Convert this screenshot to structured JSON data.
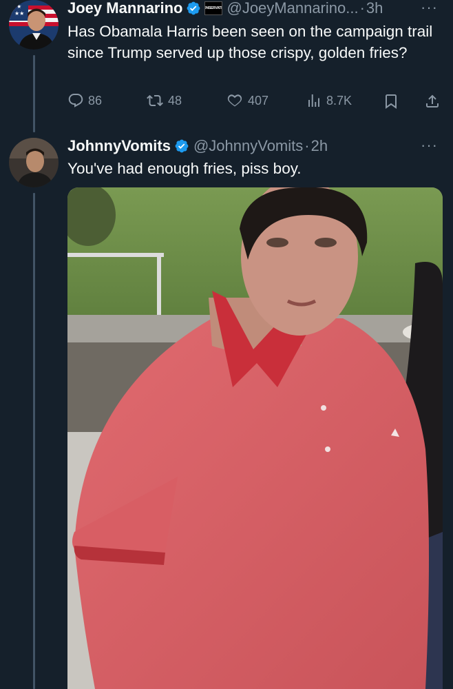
{
  "tweet1": {
    "display_name": "Joey Mannarino",
    "affiliate_badge_text": "CONSERVATIVE",
    "handle": "@JoeyMannarino...",
    "separator": "·",
    "time": "3h",
    "more": "···",
    "text": "Has Obamala Harris been seen on the campaign trail since Trump served up those crispy, golden fries?",
    "stats": {
      "replies": "86",
      "reposts": "48",
      "likes": "407",
      "views": "8.7K"
    }
  },
  "tweet2": {
    "display_name": "JohnnyVomits",
    "handle": "@JohnnyVomits",
    "separator": "·",
    "time": "2h",
    "more": "···",
    "text": "You've had enough fries, piss boy."
  },
  "colors": {
    "background": "#15202b",
    "secondary_text": "#8b98a5",
    "verified_blue": "#1d9bf0",
    "thread_line": "#425466"
  }
}
